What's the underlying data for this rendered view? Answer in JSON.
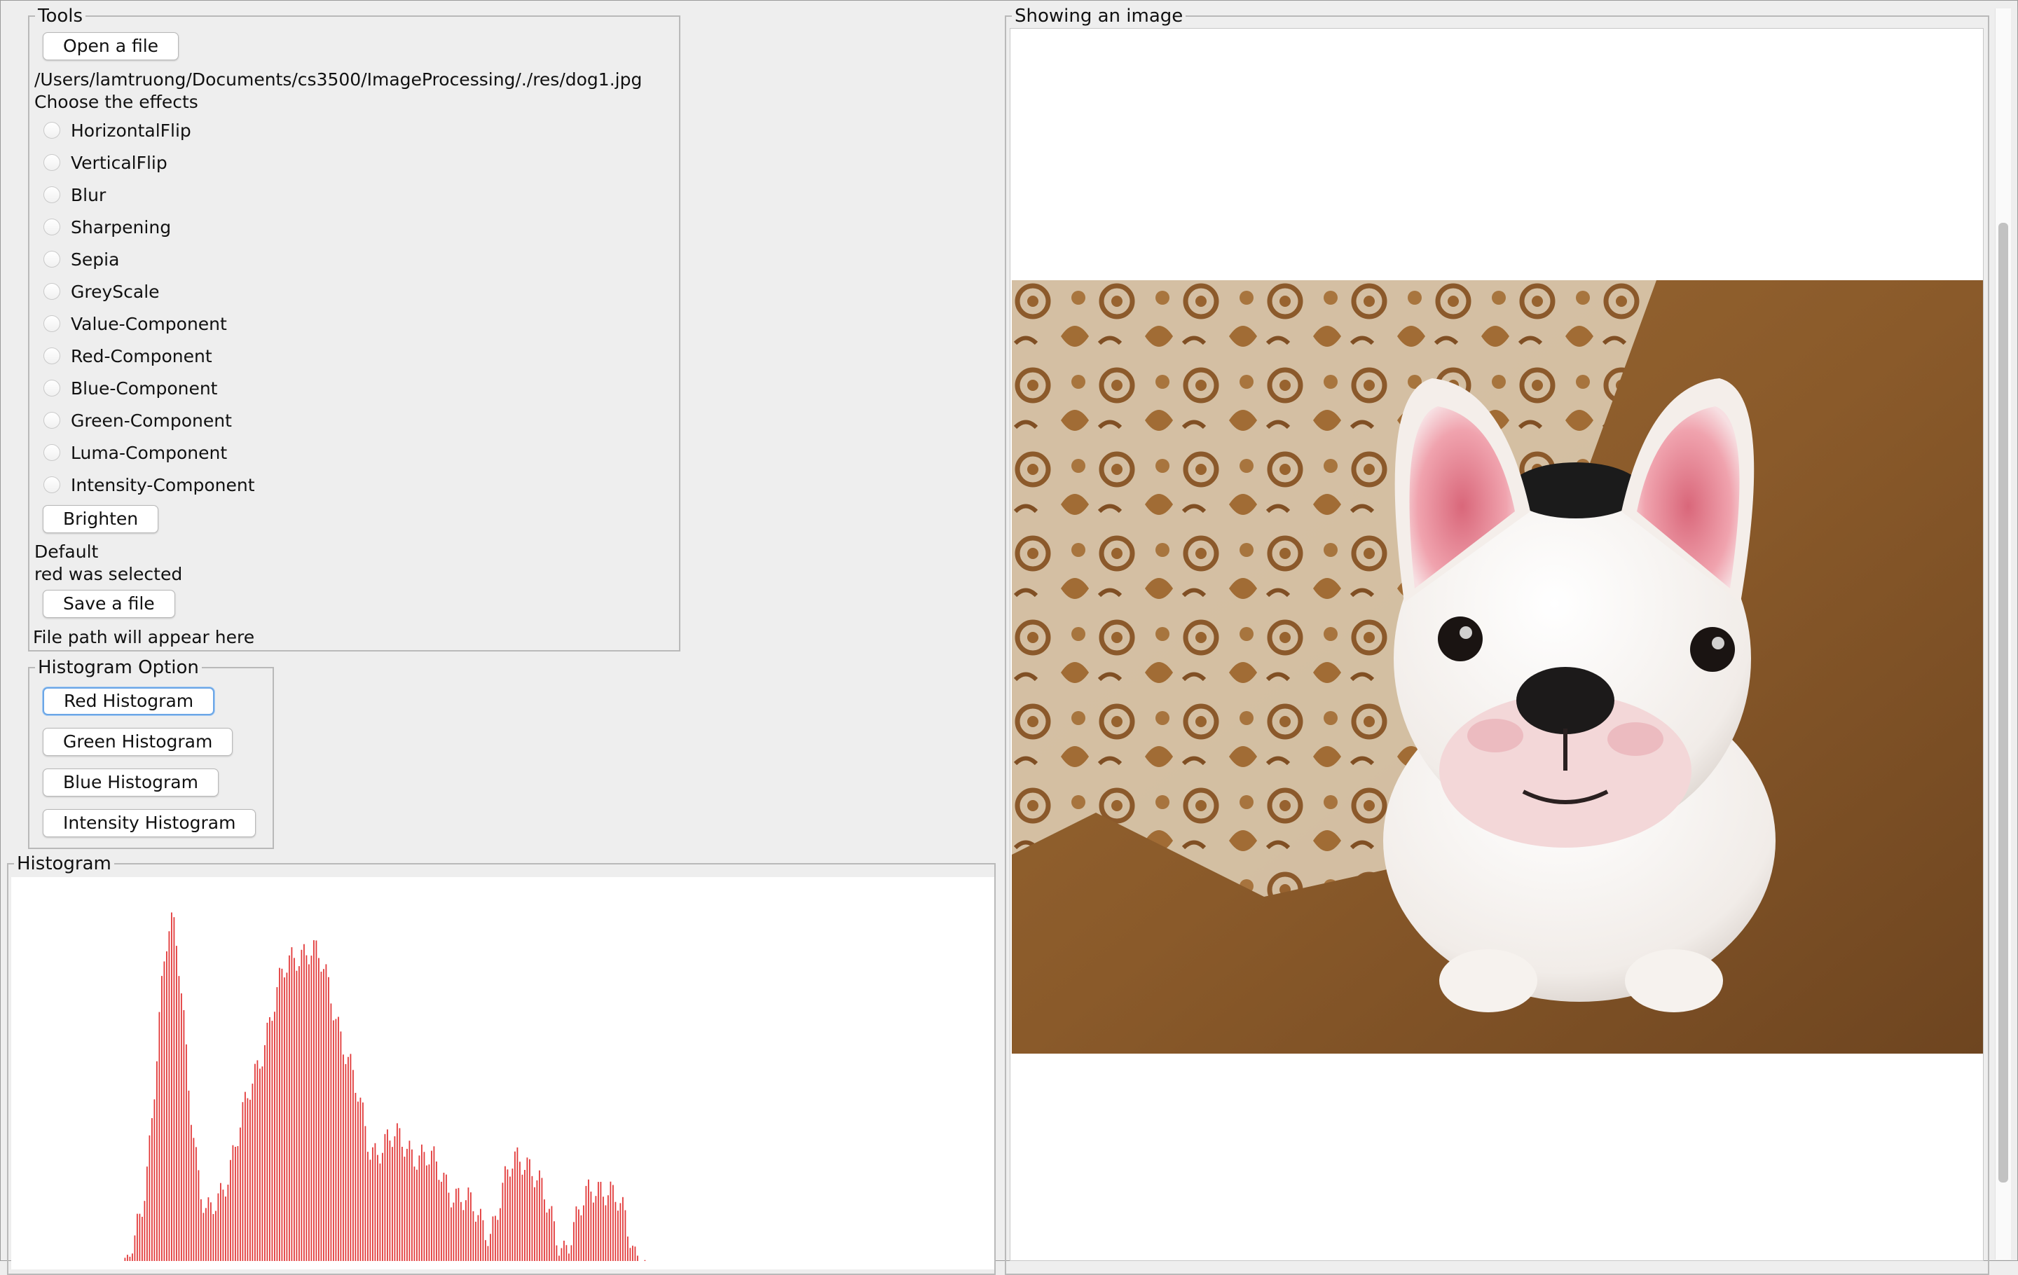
{
  "tools": {
    "legend": "Tools",
    "open_label": "Open a file",
    "file_path": "/Users/lamtruong/Documents/cs3500/ImageProcessing/./res/dog1.jpg",
    "effects_heading": "Choose the effects",
    "effects": [
      "HorizontalFlip",
      "VerticalFlip",
      "Blur",
      "Sharpening",
      "Sepia",
      "GreyScale",
      "Value-Component",
      "Red-Component",
      "Blue-Component",
      "Green-Component",
      "Luma-Component",
      "Intensity-Component"
    ],
    "brighten_label": "Brighten",
    "status_default": "Default",
    "status_selected": "red was selected",
    "save_label": "Save a file",
    "save_path_placeholder": "File path will appear here"
  },
  "histogram_option": {
    "legend": "Histogram Option",
    "red_label": "Red Histogram",
    "green_label": "Green Histogram",
    "blue_label": "Blue Histogram",
    "intensity_label": "Intensity Histogram"
  },
  "histogram": {
    "legend": "Histogram",
    "bar_color": "#e23a3a"
  },
  "image_panel": {
    "legend": "Showing an image"
  }
}
